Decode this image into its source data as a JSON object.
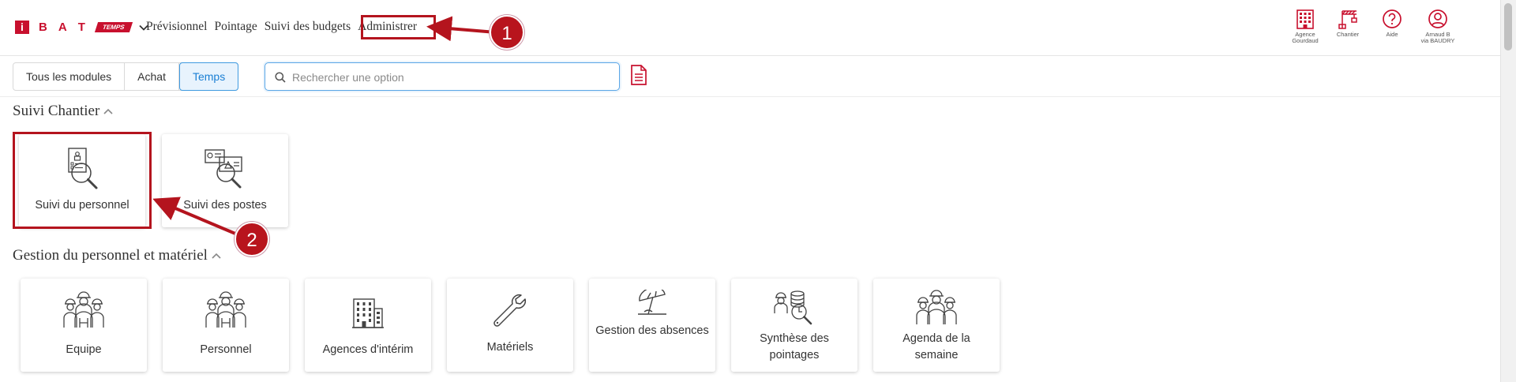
{
  "header": {
    "logo_letters": [
      "i",
      "B",
      "A",
      "T"
    ],
    "logo_badge": "TEMPS",
    "nav": [
      "Prévisionnel",
      "Pointage",
      "Suivi des budgets",
      "Administrer"
    ],
    "right_items": [
      {
        "icon": "building-icon",
        "label_line1": "Agence",
        "label_line2": "Gourdaud"
      },
      {
        "icon": "crane-icon",
        "label_line1": "Chantier",
        "label_line2": ""
      },
      {
        "icon": "help-icon",
        "label_line1": "Aide",
        "label_line2": ""
      },
      {
        "icon": "user-icon",
        "label_line1": "Arnaud B",
        "label_line2": "via BAUDRY"
      }
    ]
  },
  "toolbar": {
    "modules": [
      "Tous les modules",
      "Achat",
      "Temps"
    ],
    "active_module": "Temps",
    "search_placeholder": "Rechercher une option",
    "search_value": ""
  },
  "sections": [
    {
      "title": "Suivi Chantier",
      "cards": [
        {
          "label": "Suivi du personnel",
          "icon": "personnel-search-icon"
        },
        {
          "label": "Suivi des postes",
          "icon": "postes-search-icon"
        }
      ]
    },
    {
      "title": "Gestion du personnel et matériel",
      "cards": [
        {
          "label": "Equipe",
          "icon": "team-workers-icon"
        },
        {
          "label": "Personnel",
          "icon": "staff-workers-icon"
        },
        {
          "label": "Agences d'intérim",
          "icon": "agency-building-icon"
        },
        {
          "label": "Matériels",
          "icon": "wrench-icon"
        },
        {
          "label": "Gestion des absences",
          "icon": "beach-umbrella-icon"
        },
        {
          "label": "Synthèse des pointages",
          "icon": "timesheet-summary-icon"
        },
        {
          "label": "Agenda de la semaine",
          "icon": "week-agenda-icon"
        }
      ]
    }
  ],
  "annotations": {
    "step1": "1",
    "step2": "2",
    "color": "#b4141e"
  },
  "colors": {
    "brand": "#c8102e",
    "active_tab": "#1a7fd4",
    "search_border": "#5aa6e6"
  }
}
